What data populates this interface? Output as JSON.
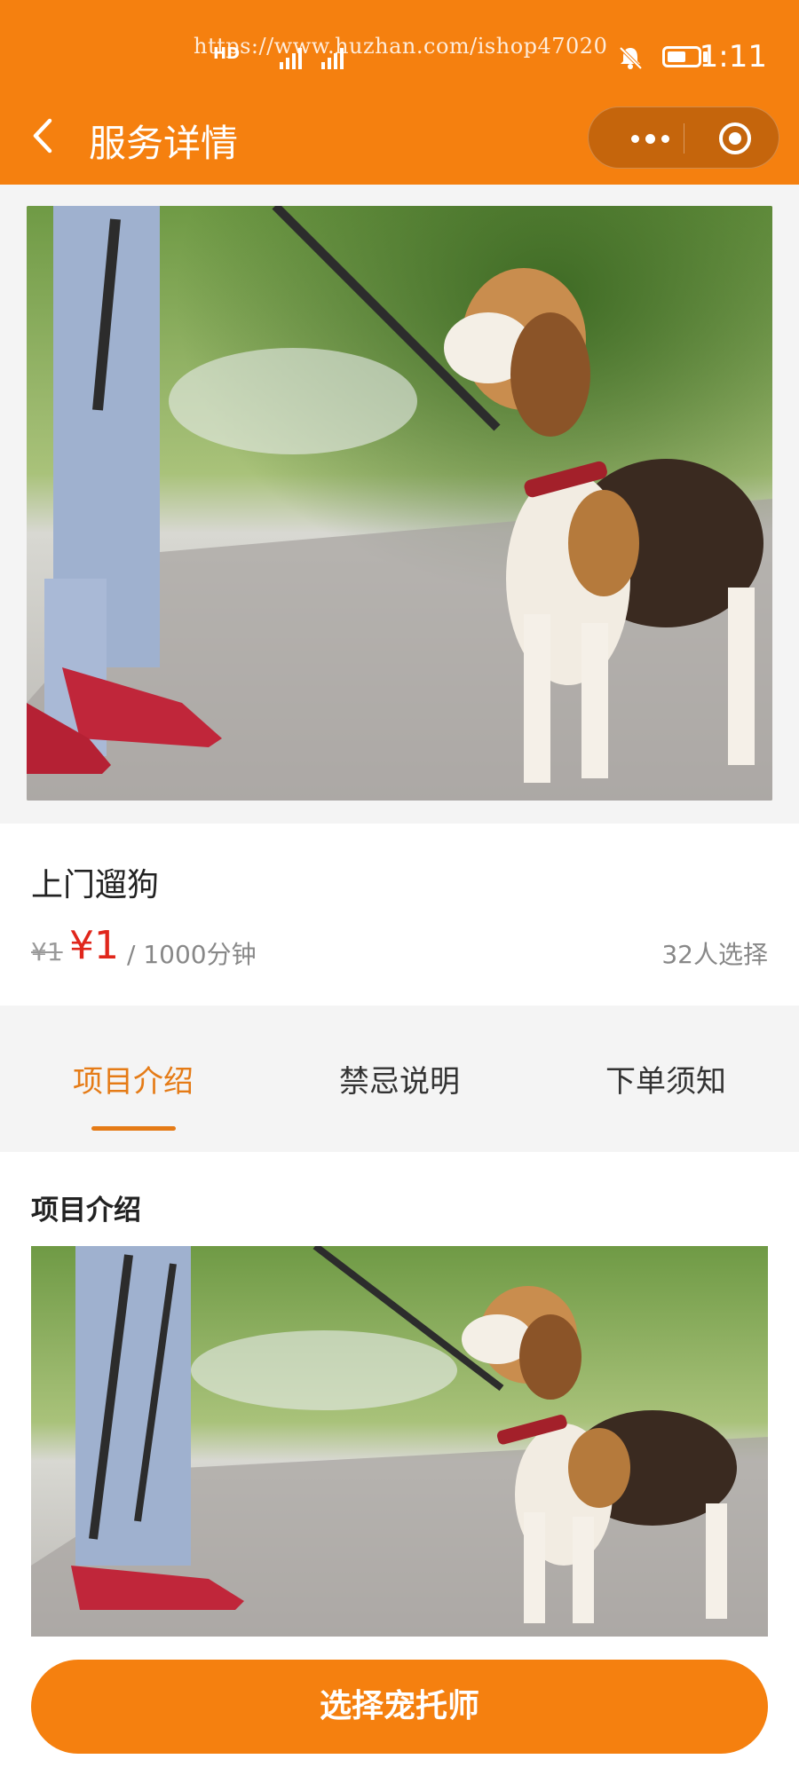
{
  "status_bar": {
    "watermark": "https://www.huzhan.com/ishop47020",
    "network": "HD",
    "time": "1:11",
    "icons": [
      "signal-icon",
      "mute-bell-icon",
      "battery-icon"
    ]
  },
  "nav": {
    "title": "服务详情",
    "back_icon": "chevron-left-icon",
    "more_icon": "more-dots-icon",
    "close_icon": "target-circle-icon"
  },
  "banner": {
    "description_icon": "dog-walking-photo"
  },
  "service": {
    "name": "上门遛狗",
    "original_price": "¥1",
    "price": "¥1",
    "unit": "/ 1000分钟",
    "selected_count": "32人选择"
  },
  "tabs": [
    {
      "label": "项目介绍",
      "active": true
    },
    {
      "label": "禁忌说明",
      "active": false
    },
    {
      "label": "下单须知",
      "active": false
    }
  ],
  "section": {
    "title": "项目介绍"
  },
  "cta": {
    "label": "选择宠托师"
  },
  "colors": {
    "brand": "#f5800f",
    "price": "#e0261b",
    "tab_active": "#e57b16"
  }
}
